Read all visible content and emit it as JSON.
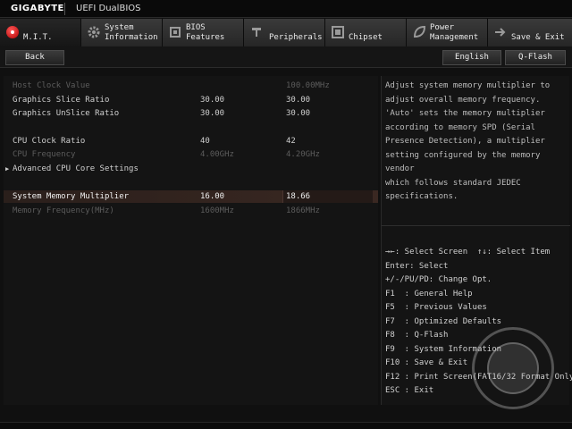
{
  "header": {
    "brand": "GIGABYTE",
    "product": "UEFI DualBIOS"
  },
  "tabs": [
    {
      "name": "tab-mit",
      "line1": "",
      "line2": "M.I.T.",
      "icon": "mit-red-dot-icon"
    },
    {
      "name": "tab-system-information",
      "line1": "System",
      "line2": "Information",
      "icon": "gear-icon"
    },
    {
      "name": "tab-bios-features",
      "line1": "BIOS",
      "line2": "Features",
      "icon": "bios-chip-icon"
    },
    {
      "name": "tab-peripherals",
      "line1": "",
      "line2": "Peripherals",
      "icon": "peripherals-icon"
    },
    {
      "name": "tab-chipset",
      "line1": "",
      "line2": "Chipset",
      "icon": "chipset-icon"
    },
    {
      "name": "tab-power-management",
      "line1": "Power",
      "line2": "Management",
      "icon": "power-leaf-icon"
    },
    {
      "name": "tab-save-exit",
      "line1": "",
      "line2": "Save & Exit",
      "icon": "exit-arrow-icon"
    }
  ],
  "actions": {
    "back": "Back",
    "language": "English",
    "qflash": "Q-Flash"
  },
  "settings": [
    {
      "name": "Host Clock Value",
      "current": "",
      "value": "100.00MHz",
      "dim": true
    },
    {
      "name": "Graphics Slice Ratio",
      "current": "30.00",
      "value": "30.00",
      "dim": false
    },
    {
      "name": "Graphics UnSlice Ratio",
      "current": "30.00",
      "value": "30.00",
      "dim": false
    },
    {
      "name": "CPU Clock Ratio",
      "current": "40",
      "value": "42",
      "dim": false
    },
    {
      "name": "CPU Frequency",
      "current": "4.00GHz",
      "value": "4.20GHz",
      "dim": true
    },
    {
      "name": "Advanced CPU Core Settings",
      "current": "",
      "value": "",
      "dim": false,
      "submenu": true
    },
    {
      "name": "System Memory Multiplier",
      "current": "16.00",
      "value": "18.66",
      "dim": false,
      "selected": true
    },
    {
      "name": "Memory Frequency(MHz)",
      "current": "1600MHz",
      "value": "1866MHz",
      "dim": true
    }
  ],
  "help": {
    "description": "Adjust system memory multiplier to\nadjust overall memory frequency.\n'Auto' sets the memory multiplier\naccording to memory SPD (Serial\nPresence Detection), a multiplier\nsetting configured by the memory vendor\nwhich follows standard JEDEC\nspecifications.",
    "keys": [
      "→←: Select Screen  ↑↓: Select Item",
      "Enter: Select",
      "+/-/PU/PD: Change Opt.",
      "F1  : General Help",
      "F5  : Previous Values",
      "F7  : Optimized Defaults",
      "F8  : Q-Flash",
      "F9  : System Information",
      "F10 : Save & Exit",
      "F12 : Print Screen(FAT16/32 Format Only)",
      "ESC : Exit"
    ]
  },
  "colors": {
    "accent_red": "#c00000",
    "selected_row": "#3a2822",
    "background": "#101010"
  }
}
